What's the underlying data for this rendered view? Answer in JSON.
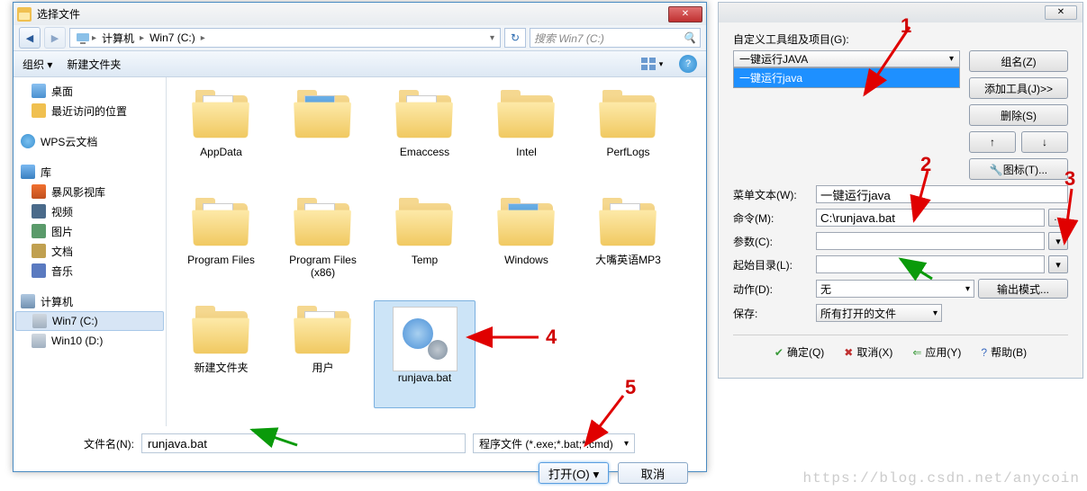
{
  "dialog": {
    "title": "选择文件",
    "nav": {
      "computer": "计算机",
      "drive": "Win7 (C:)"
    },
    "search_placeholder": "搜索 Win7 (C:)",
    "toolbar": {
      "organize": "组织 ▾",
      "newfolder": "新建文件夹"
    },
    "sidebar": {
      "desktop": "桌面",
      "recent": "最近访问的位置",
      "wps": "WPS云文档",
      "lib": "库",
      "bf": "暴风影视库",
      "video": "视频",
      "pic": "图片",
      "doc": "文档",
      "music": "音乐",
      "computer": "计算机",
      "win7": "Win7 (C:)",
      "win10": "Win10 (D:)"
    },
    "files": {
      "appdata": "AppData",
      "blank2": "",
      "emaccess": "Emaccess",
      "intel": "Intel",
      "perflogs": "PerfLogs",
      "progfiles": "Program Files",
      "progfiles86": "Program Files (x86)",
      "temp": "Temp",
      "windows": "Windows",
      "dazui": "大嘴英语MP3",
      "newfolder": "新建文件夹",
      "user": "用户",
      "runjava": "runjava.bat"
    },
    "filename_label": "文件名(N):",
    "filename_value": "runjava.bat",
    "filter": "程序文件 (*.exe;*.bat;*.cmd)",
    "open_btn": "打开(O)",
    "cancel_btn": "取消"
  },
  "right": {
    "group_label": "自定义工具组及项目(G):",
    "group_combo": "一键运行JAVA",
    "list_item": "一键运行java",
    "btn_groupname": "组名(Z)",
    "btn_addtool": "添加工具(J)>>",
    "btn_delete": "删除(S)",
    "btn_up": "↑",
    "btn_down": "↓",
    "btn_icon": "🔧图标(T)...",
    "menu_label": "菜单文本(W):",
    "menu_value": "一键运行java",
    "cmd_label": "命令(M):",
    "cmd_value": "C:\\runjava.bat",
    "param_label": "参数(C):",
    "param_value": "",
    "startdir_label": "起始目录(L):",
    "startdir_value": "",
    "action_label": "动作(D):",
    "action_value": "无",
    "output_btn": "输出模式...",
    "save_label": "保存:",
    "save_value": "所有打开的文件",
    "ok": "确定(Q)",
    "cancel": "取消(X)",
    "apply": "应用(Y)",
    "help": "帮助(B)"
  },
  "annotations": {
    "n1": "1",
    "n2": "2",
    "n3": "3",
    "n4": "4",
    "n5": "5"
  },
  "watermark": "https://blog.csdn.net/anycoin"
}
